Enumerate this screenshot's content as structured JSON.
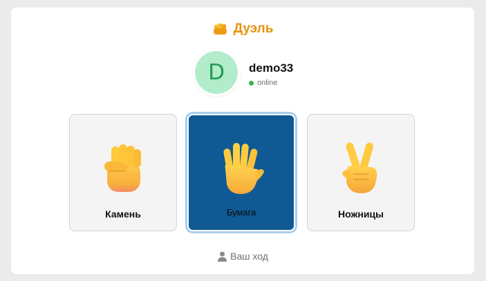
{
  "header": {
    "title": "Дуэль",
    "title_icon": "oncoming-fist-icon",
    "accent_color": "#e8920e"
  },
  "opponent": {
    "avatar_letter": "D",
    "avatar_bg": "#b3ecca",
    "avatar_fg": "#1f9c52",
    "username": "demo33",
    "status": "online",
    "status_color": "#2fb84f"
  },
  "choices": [
    {
      "label": "Камень",
      "icon": "raised-fist-icon",
      "selected": false
    },
    {
      "label": "Бумага",
      "icon": "raised-hand-icon",
      "selected": true
    },
    {
      "label": "Ножницы",
      "icon": "victory-hand-icon",
      "selected": false
    }
  ],
  "selected_color": "#0f5a94",
  "footer": {
    "turn_text": "Ваш ход",
    "icon": "user-icon"
  }
}
